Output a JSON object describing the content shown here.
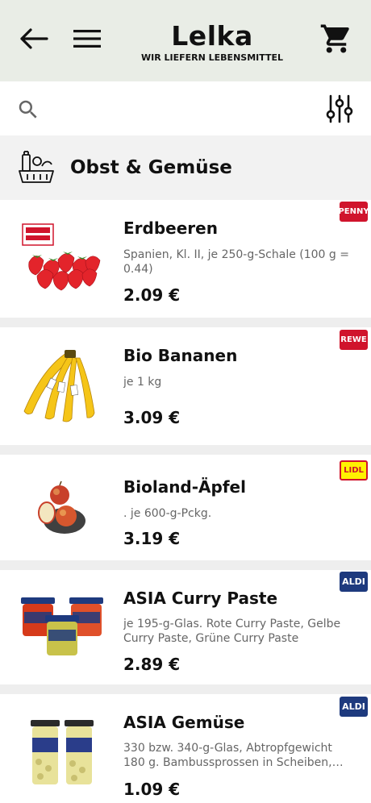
{
  "header": {
    "title": "Lelka",
    "subtitle": "WIR LIEFERN LEBENSMITTEL",
    "back_icon": "arrow-left-icon",
    "menu_icon": "hamburger-icon",
    "cart_icon": "shopping-cart-icon"
  },
  "search": {
    "value": "",
    "placeholder": "",
    "filter_icon": "sliders-icon"
  },
  "category": {
    "title": "Obst & Gemüse",
    "icon": "groceries-icon"
  },
  "products": [
    {
      "name": "Erdbeeren",
      "description": "Spanien, Kl. II, je 250-g-Schale (100 g = 0.44)",
      "price": "2.09 €",
      "store": "PENNY",
      "image": "strawberries"
    },
    {
      "name": "Bio Bananen",
      "description": "je 1 kg",
      "price": "3.09 €",
      "store": "REWE",
      "image": "bananas"
    },
    {
      "name": "Bioland-Äpfel",
      "description": ". je 600-g-Pckg.",
      "price": "3.19 €",
      "store": "LIDL",
      "image": "apples"
    },
    {
      "name": "ASIA Curry Paste",
      "description": "je 195-g-Glas. Rote Curry Paste, Gelbe Curry Paste, Grüne Curry Paste",
      "price": "2.89 €",
      "store": "ALDI",
      "image": "curry-jars"
    },
    {
      "name": "ASIA Gemüse",
      "description": "330 bzw. 340-g-Glas, Abtropfgewicht 180 g. Bambussprossen in Scheiben, M…",
      "price": "1.09 €",
      "store": "ALDI",
      "image": "vegetable-jars"
    }
  ],
  "colors": {
    "appbar": "#e9ede6",
    "penny": "#d0142c",
    "rewe": "#d0142c",
    "lidl_yellow": "#fff200",
    "aldi_blue": "#1e3a7e"
  }
}
